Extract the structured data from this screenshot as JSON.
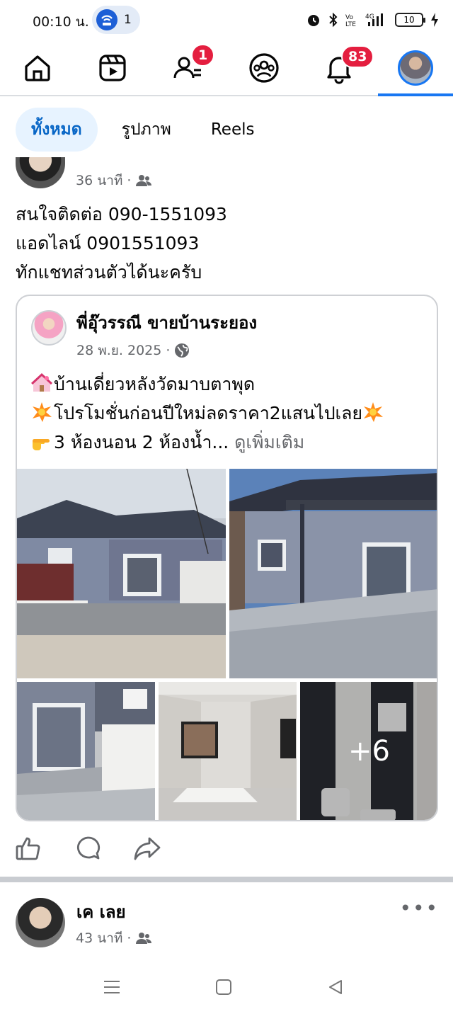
{
  "status_bar": {
    "time": "00:10 น.",
    "hotspot_count": "1",
    "battery": "10",
    "network": "4G"
  },
  "top_nav": {
    "friends_badge": "1",
    "notifications_badge": "83"
  },
  "filter_tabs": [
    "ทั้งหมด",
    "รูปภาพ",
    "Reels"
  ],
  "post": {
    "time": "36 นาที",
    "lines": [
      "สนใจติดต่อ 090-1551093",
      "แอดไลน์ 0901551093",
      "ทักแชทส่วนตัวได้นะครับ"
    ],
    "shared": {
      "author": "พี่อุ๊วรรณี ขายบ้านระยอง",
      "date": "28 พ.ย. 2025",
      "line1": "บ้านเดี่ยวหลังวัดมาบตาพุด",
      "line2": "โปรโมชั่นก่อนปีใหม่ลดราคา2แสนไปเลย",
      "line3": "3 ห้องนอน 2 ห้องน้ำ...",
      "see_more": "ดูเพิ่มเติม",
      "extra_photos": "+6"
    }
  },
  "next_post": {
    "author": "เค เลย",
    "time": "43 นาที"
  },
  "icons": {
    "home": "home-icon",
    "video": "video-icon",
    "friends": "friends-icon",
    "groups": "groups-icon",
    "bell": "bell-icon",
    "like": "like-icon",
    "comment": "comment-icon",
    "share": "share-icon"
  },
  "colors": {
    "accent": "#1877f2",
    "badge": "#e41e3f",
    "muted": "#65676b"
  }
}
